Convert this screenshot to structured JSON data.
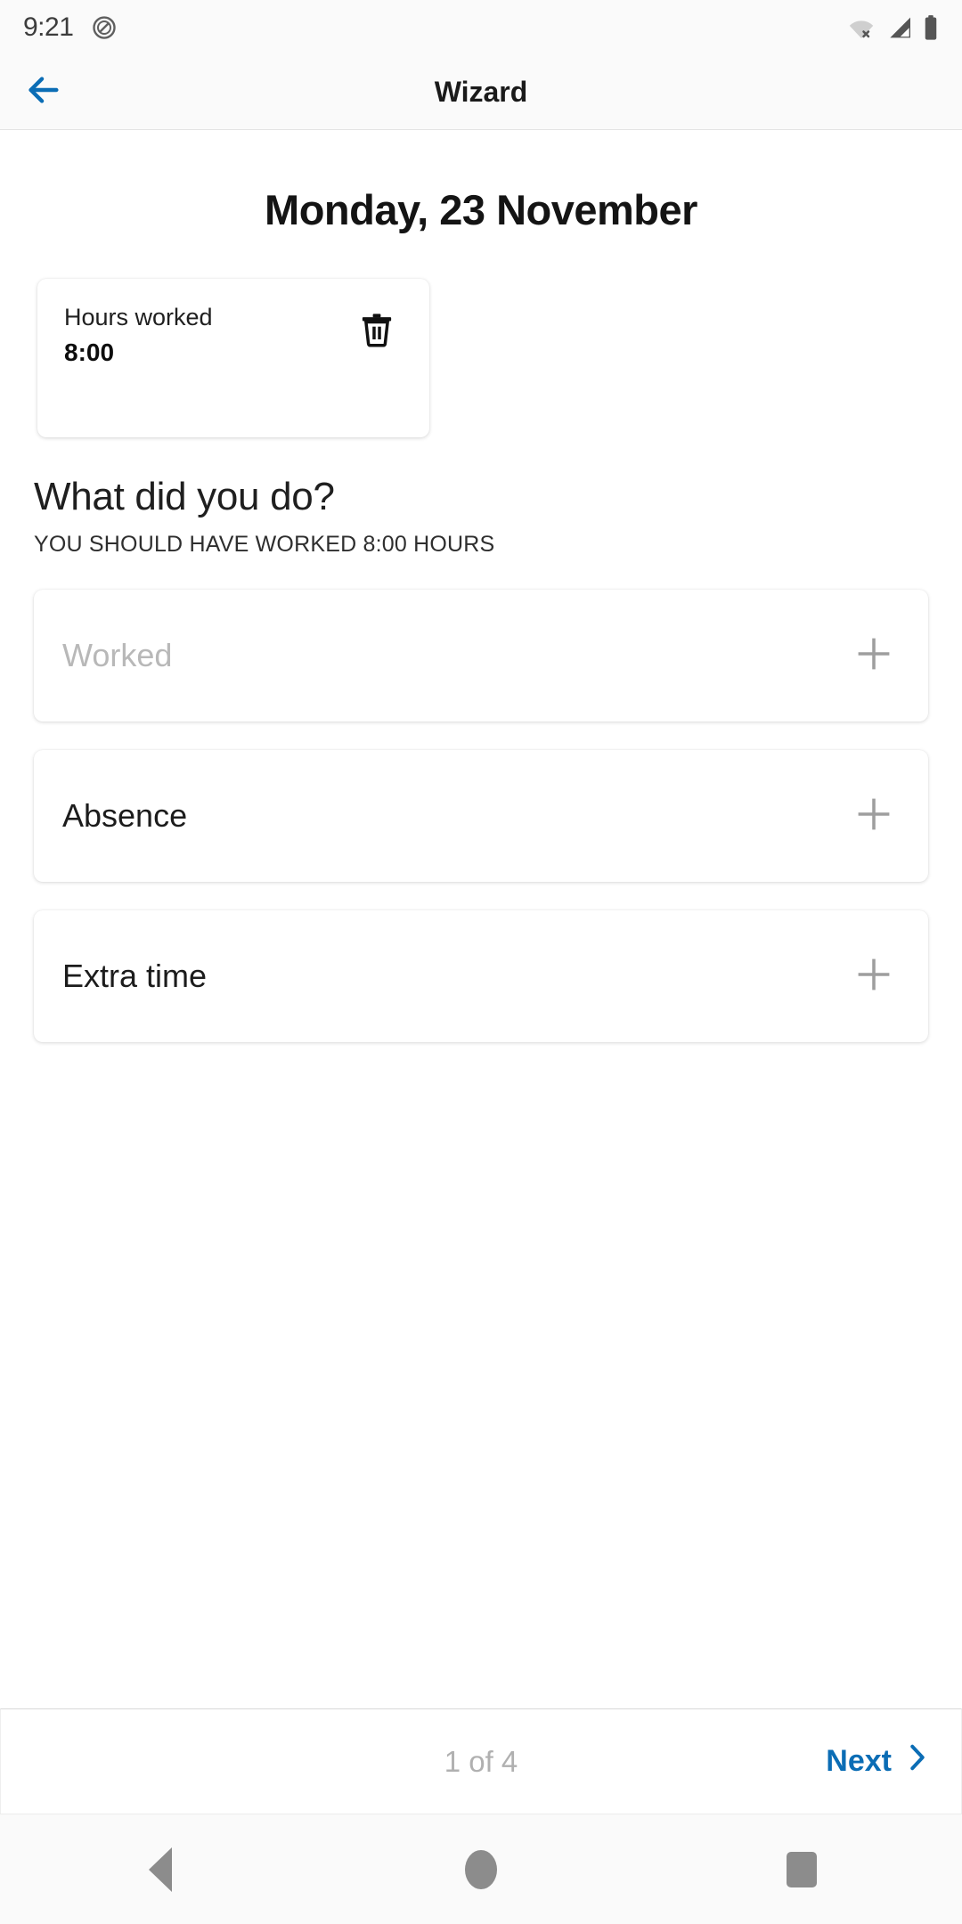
{
  "status_bar": {
    "time": "9:21",
    "icons": [
      "dnd-icon",
      "wifi-off-icon",
      "cellular-signal-icon",
      "battery-icon"
    ]
  },
  "app_bar": {
    "back_icon": "arrow-back-icon",
    "title": "Wizard",
    "accent_color": "#0b6db5"
  },
  "main": {
    "date_title": "Monday, 23 November",
    "hours_card": {
      "label": "Hours worked",
      "value": "8:00",
      "delete_icon": "trash-icon"
    },
    "question": "What did you do?",
    "question_sub": "YOU SHOULD HAVE WORKED 8:00 HOURS",
    "options": [
      {
        "label": "Worked",
        "muted": true,
        "add_icon": "plus-icon"
      },
      {
        "label": "Absence",
        "muted": false,
        "add_icon": "plus-icon"
      },
      {
        "label": "Extra time",
        "muted": false,
        "add_icon": "plus-icon"
      }
    ]
  },
  "bottom_bar": {
    "page_indicator": "1 of 4",
    "next_label": "Next",
    "next_icon": "chevron-right-icon"
  },
  "nav_bar": {
    "back": "nav-back-icon",
    "home": "nav-home-icon",
    "recents": "nav-recents-icon"
  }
}
